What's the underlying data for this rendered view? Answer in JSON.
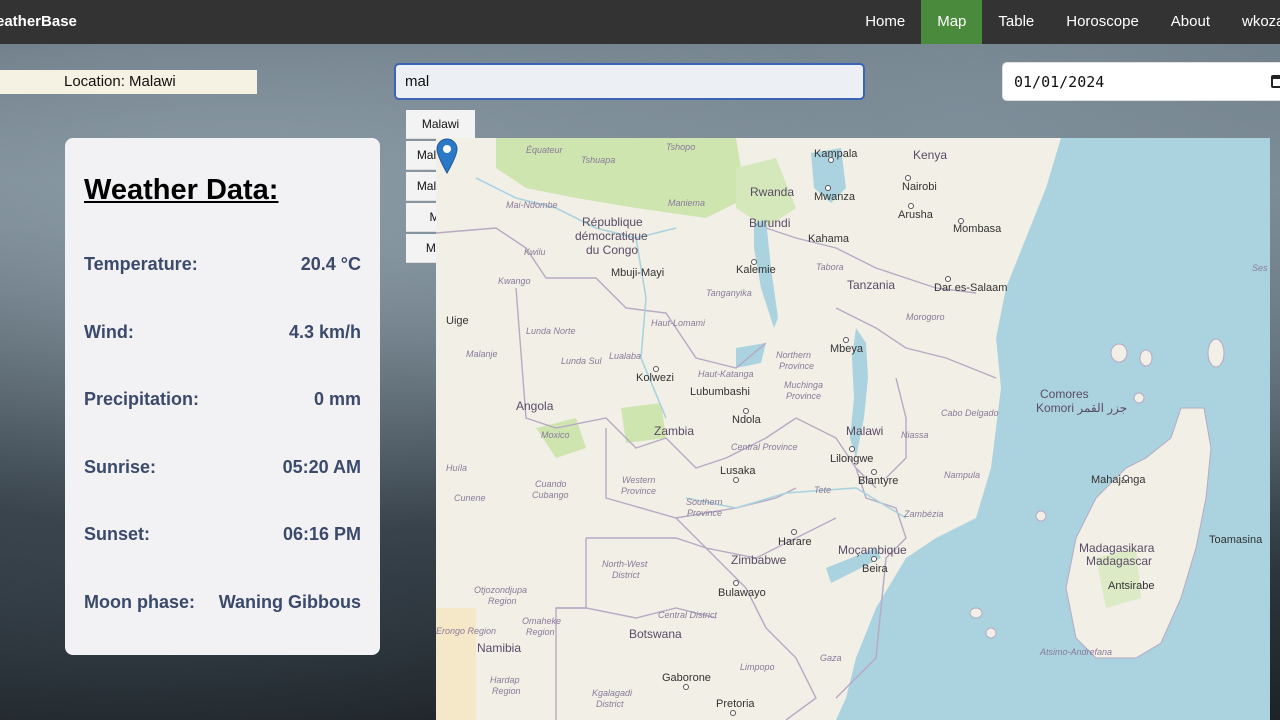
{
  "brand": "eatherBase",
  "nav": [
    "Home",
    "Map",
    "Table",
    "Horoscope",
    "About",
    "wkoza"
  ],
  "location": "Location: Malawi",
  "search": {
    "value": "mal"
  },
  "suggestions": [
    "Malawi",
    "Malaysia",
    "Maldives",
    "Mali",
    "Malta"
  ],
  "date": "01/01/2024",
  "weather": {
    "title": "Weather Data:",
    "rows": [
      {
        "label": "Temperature:",
        "value": "20.4 °C"
      },
      {
        "label": "Wind:",
        "value": "4.3 km/h"
      },
      {
        "label": "Precipitation:",
        "value": "0 mm"
      },
      {
        "label": "Sunrise:",
        "value": "05:20 AM"
      },
      {
        "label": "Sunset:",
        "value": "06:16 PM"
      },
      {
        "label": "Moon phase:",
        "value": "Waning Gibbous"
      }
    ]
  },
  "map": {
    "countries": [
      "République démocratique du Congo",
      "Angola",
      "Zambia",
      "Zimbabwe",
      "Tanzania",
      "Kenya",
      "Rwanda",
      "Burundi",
      "Moçambique",
      "Botswana",
      "Namibia",
      "Comores",
      "Madagasikara Madagascar",
      "Malawi"
    ],
    "cities": [
      "Kampala",
      "Nairobi",
      "Mwanza",
      "Arusha",
      "Mombasa",
      "Kahama",
      "Kalemie",
      "Mbuji-Mayi",
      "Dar es-Salaam",
      "Mbeya",
      "Kolwezi",
      "Lubumbashi",
      "Ndola",
      "Lusaka",
      "Lilongwe",
      "Blantyre",
      "Harare",
      "Bulawayo",
      "Beira",
      "Gaborone",
      "Pretoria",
      "Mahajanga",
      "Antsirabe",
      "Toamasina",
      "Uige"
    ],
    "regions": [
      "Équateur",
      "Tshuapa",
      "Tshopo",
      "Mai-Ndombe",
      "Maniema",
      "Kwilu",
      "Kwango",
      "Lunda Norte",
      "Lunda Sul",
      "Lualaba",
      "Malanje",
      "Haut-Lomami",
      "Haut-Katanga",
      "Tanganyika",
      "Tabora",
      "Morogoro",
      "Northern Province",
      "Muchinga Province",
      "Central Province",
      "Western Province",
      "Southern Province",
      "Niassa",
      "Cabo Delgado",
      "Nampula",
      "Zambézia",
      "Tete",
      "Huíla",
      "Cunene",
      "Cuando Cubango",
      "North-West District",
      "Otjozondjupa Region",
      "Omaheke Region",
      "Erongo Region",
      "Central District",
      "Hardap Region",
      "Kgalagadi District",
      "Limpopo",
      "Gaza",
      "Atsimo-Andrefana",
      "Moxico",
      "Komori جزر القمر",
      "Ses"
    ]
  },
  "colors": {
    "nav_active": "#4a8a3c",
    "water": "#aad3df",
    "land": "#f1efe6",
    "pin": "#2a78c6"
  }
}
